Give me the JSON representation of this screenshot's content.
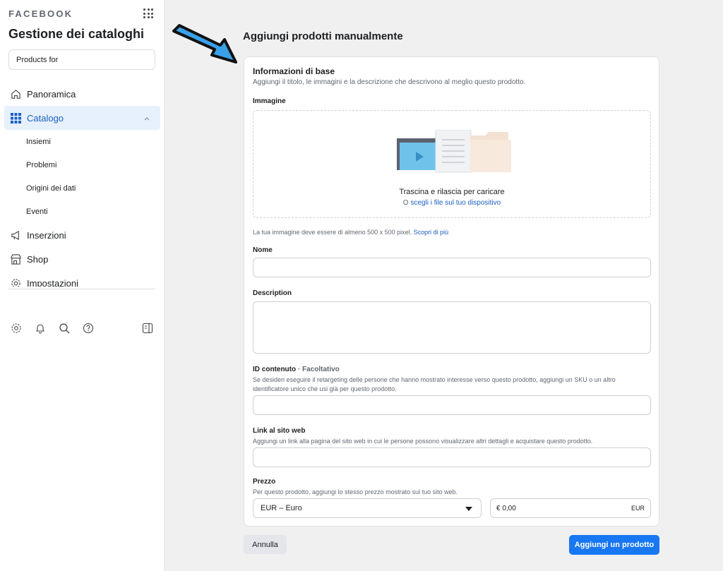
{
  "sidebar": {
    "brand": "FACEBOOK",
    "title": "Gestione dei cataloghi",
    "catalog_select": "Products for",
    "nav": [
      {
        "label": "Panoramica",
        "icon": "home-icon"
      },
      {
        "label": "Catalogo",
        "icon": "grid-icon",
        "active": true
      },
      {
        "label": "Inserzioni",
        "icon": "megaphone-icon"
      },
      {
        "label": "Shop",
        "icon": "shop-icon"
      },
      {
        "label": "Impostazioni",
        "icon": "gear-icon"
      }
    ],
    "sub_items": [
      "Insiemi",
      "Problemi",
      "Origini dei dati",
      "Eventi"
    ],
    "bottom_icons": [
      "settings-icon",
      "bell-icon",
      "search-icon",
      "help-icon",
      "panel-toggle-icon"
    ]
  },
  "main": {
    "page_title": "Aggiungi prodotti manualmente",
    "section": {
      "title": "Informazioni di base",
      "subtitle": "Aggiungi il titolo, le immagini e la descrizione che descrivono al meglio questo prodotto."
    },
    "image": {
      "label": "Immagine",
      "drop_text": "Trascina e rilascia per caricare",
      "or_prefix": "O",
      "choose_link": "scegli i file sul tuo dispositivo",
      "help_text": "La tua immagine deve essere di almeno 500 x 500 pixel.",
      "learn_more": "Scopri di più"
    },
    "name": {
      "label": "Nome",
      "value": ""
    },
    "description": {
      "label": "Description",
      "value": ""
    },
    "content_id": {
      "label": "ID contenuto",
      "optional": "· Facoltativo",
      "help_text": "Se desideri eseguire il retargeting delle persone che hanno mostrato interesse verso questo prodotto, aggiungi un SKU o un altro identificatore unico che usi già per questo prodotto.",
      "value": ""
    },
    "website_link": {
      "label": "Link al sito web",
      "help_text": "Aggiungi un link alla pagina del sito web in cui le persone possono visualizzare altri dettagli e acquistare questo prodotto.",
      "value": ""
    },
    "price": {
      "label": "Prezzo",
      "help_text": "Per questo prodotto, aggiungi lo stesso prezzo mostrato sul tuo sito web.",
      "currency": "EUR – Euro",
      "amount": "€ 0,00",
      "currency_code": "EUR"
    }
  },
  "actions": {
    "cancel": "Annulla",
    "add": "Aggiungi un prodotto"
  },
  "colors": {
    "accent": "#1877f2",
    "active_nav_bg": "#e7f0fd",
    "arrow": "#3aa0e8"
  }
}
